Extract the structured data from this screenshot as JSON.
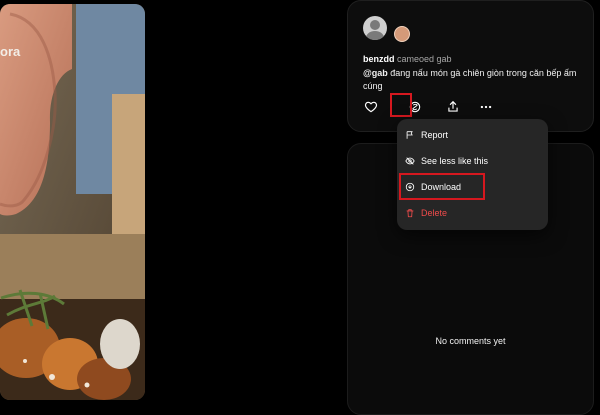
{
  "video": {
    "overlay_text": "ora"
  },
  "post": {
    "username": "benzdd",
    "action_text": "cameoed gab",
    "mention": "@gab",
    "caption_rest": " đang nấu món gà chiên giòn trong căn bếp ấm cúng",
    "actions": {
      "like_icon": "heart-icon",
      "remix_icon": "remix-icon",
      "share_icon": "share-icon",
      "more_icon": "more-icon"
    }
  },
  "menu": {
    "items": [
      {
        "label": "Report",
        "icon": "flag-icon"
      },
      {
        "label": "See less like this",
        "icon": "eye-off-icon"
      },
      {
        "label": "Download",
        "icon": "download-icon"
      },
      {
        "label": "Delete",
        "icon": "trash-icon",
        "color": "#ef4b4b"
      }
    ]
  },
  "comments": {
    "empty_text": "No comments yet"
  },
  "colors": {
    "highlight": "#d6181f",
    "delete": "#ef4b4b",
    "menu_bg": "#262626"
  }
}
